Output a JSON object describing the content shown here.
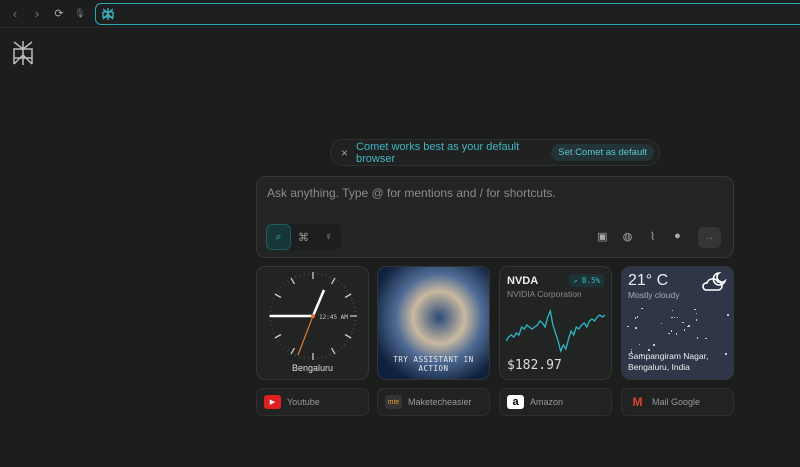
{
  "browser": {
    "back": "‹",
    "forward": "›",
    "reload": "⟳",
    "mic": "🎙",
    "url": ""
  },
  "banner": {
    "close": "×",
    "message": "Comet works best as your default browser",
    "action": "Set Comet as default"
  },
  "search": {
    "placeholder": "Ask anything. Type @ for mentions and / for shortcuts.",
    "send": "→"
  },
  "widgets": {
    "clock": {
      "time": "12:45 AM",
      "city": "Bengaluru"
    },
    "assistant": {
      "caption": "TRY ASSISTANT IN ACTION"
    },
    "stock": {
      "ticker": "NVDA",
      "name": "NVIDIA Corporation",
      "change": "↗ 8.5%",
      "price": "$182.97",
      "sparkline": [
        40,
        42,
        43,
        42,
        44,
        43,
        47,
        46,
        48,
        47,
        46,
        47,
        48,
        50,
        49,
        47,
        52,
        55,
        48,
        44,
        40,
        35,
        38,
        36,
        41,
        45,
        43,
        47,
        46,
        48,
        49,
        47,
        50,
        51,
        50,
        52,
        53,
        52,
        53
      ]
    },
    "weather": {
      "temp": "21° C",
      "condition": "Mostly cloudy",
      "location_line1": "Sampangiram Nagar,",
      "location_line2": "Bengaluru, India"
    }
  },
  "shortcuts": [
    {
      "label": "Youtube",
      "icon": "▶",
      "color": "#e02020"
    },
    {
      "label": "Maketecheasier",
      "icon": "mte",
      "color": "#333"
    },
    {
      "label": "Amazon",
      "icon": "a",
      "color": "#ffffff"
    },
    {
      "label": "Mail Google",
      "icon": "M",
      "color": "#1c1d1d"
    }
  ]
}
